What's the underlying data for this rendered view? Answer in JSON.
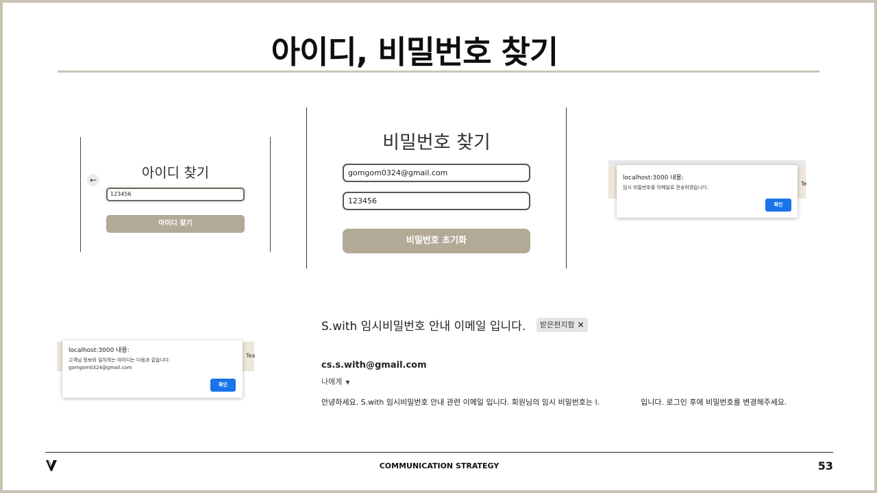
{
  "slide": {
    "title": "아이디, 비밀번호 찾기",
    "footer_label": "COMMUNICATION STRATEGY",
    "page_number": "53"
  },
  "find_id": {
    "title": "아이디 찾기",
    "back_icon": "arrow-left-icon",
    "input_value": "123456",
    "button_label": "아이디 찾기"
  },
  "find_password": {
    "title": "비밀번호 찾기",
    "email_value": "gomgom0324@gmail.com",
    "code_value": "123456",
    "button_label": "비밀번호 초기화"
  },
  "alert_password": {
    "origin": "localhost:3000 내용:",
    "message": "임시 비밀번호를 이메일로 전송하였습니다.",
    "ok_label": "확인",
    "side_text": "Te"
  },
  "alert_id": {
    "origin": "localhost:3000 내용:",
    "message": "고객님 정보와 일치하는 아이디는 다음과 같습니다.",
    "result": "gomgom0324@gmail.com",
    "ok_label": "확인",
    "side_text": "Tea"
  },
  "email": {
    "subject": "S.with 임시비밀번호 안내 이메일 입니다.",
    "badge_label": "받은편지함",
    "badge_close": "×",
    "sender": "cs.s.with@gmail.com",
    "recipient": "나에게",
    "body_before": "안녕하세요. S.with 임시비밀번호 안내 관련 이메일 입니다. 회원님의 임시 비밀번호는 l.",
    "body_after": "입니다. 로그인 후에 비밀번호를 변경해주세요."
  },
  "colors": {
    "accent_button": "#b2aa97",
    "frame": "#c9c3b3",
    "dialog_ok": "#1a73e8"
  }
}
